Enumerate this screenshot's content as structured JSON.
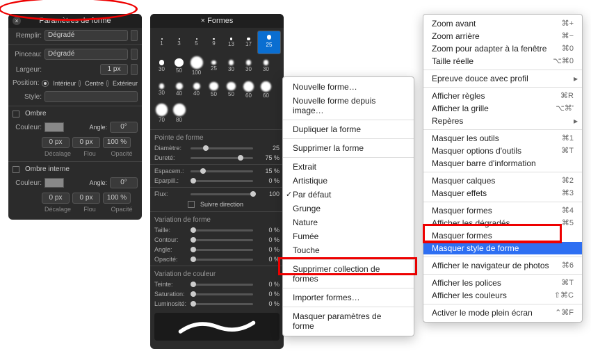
{
  "panel1": {
    "title": "Paramètres de forme",
    "fill_label": "Remplir:",
    "fill_value": "Dégradé",
    "brush_label": "Pinceau:",
    "brush_value": "Dégradé",
    "width_label": "Largeur:",
    "width_value": "1 px",
    "position_label": "Position:",
    "pos_inner": "Intérieur",
    "pos_center": "Centre",
    "pos_outer": "Extérieur",
    "style_label": "Style:",
    "shadow_label": "Ombre",
    "color_label": "Couleur:",
    "angle_label": "Angle:",
    "angle_value": "0°",
    "offset_value": "0 px",
    "blur_value": "0 px",
    "opacity_value": "100 %",
    "sub_offset": "Décalage",
    "sub_blur": "Flou",
    "sub_opacity": "Opacité",
    "inner_shadow_label": "Ombre interne"
  },
  "panel2": {
    "title": "Formes",
    "brushes": [
      1,
      3,
      5,
      9,
      13,
      17,
      25,
      30,
      50,
      100,
      25,
      30,
      30,
      30,
      30,
      40,
      40,
      50,
      50,
      60,
      60,
      70,
      80
    ],
    "selected_index": 6,
    "sec_tip": "Pointe de forme",
    "diam_label": "Diamètre:",
    "diam_value": "25",
    "hard_label": "Dureté:",
    "hard_value": "75 %",
    "spacing_label": "Espacem.:",
    "spacing_value": "15 %",
    "scatter_label": "Eparpill.:",
    "scatter_value": "0 %",
    "flux_label": "Flux:",
    "flux_value": "100",
    "follow_label": "Suivre direction",
    "sec_shape": "Variation de forme",
    "size_label": "Taille:",
    "size_value": "0 %",
    "contour_label": "Contour:",
    "contour_value": "0 %",
    "angle2_label": "Angle:",
    "angle2_value": "0 %",
    "opacity2_label": "Opacité:",
    "opacity2_value": "0 %",
    "sec_color": "Variation de couleur",
    "hue_label": "Teinte:",
    "hue_value": "0 %",
    "sat_label": "Saturation:",
    "sat_value": "0 %",
    "lum_label": "Luminosité:",
    "lum_value": "0 %"
  },
  "menu1": {
    "items": [
      {
        "label": "Nouvelle forme…"
      },
      {
        "label": "Nouvelle forme depuis image…"
      },
      {
        "sep": true
      },
      {
        "label": "Dupliquer la forme"
      },
      {
        "sep": true
      },
      {
        "label": "Supprimer la forme"
      },
      {
        "sep": true
      },
      {
        "label": "Extrait"
      },
      {
        "label": "Artistique"
      },
      {
        "label": "Par défaut",
        "checked": true
      },
      {
        "label": "Grunge"
      },
      {
        "label": "Nature"
      },
      {
        "label": "Fumée"
      },
      {
        "label": "Touche"
      },
      {
        "sep": true
      },
      {
        "label": "Supprimer collection de formes"
      },
      {
        "sep": true
      },
      {
        "label": "Importer formes…"
      },
      {
        "sep": true
      },
      {
        "label": "Masquer paramètres de forme"
      }
    ]
  },
  "menu2": {
    "items": [
      {
        "label": "Zoom avant",
        "shortcut": "⌘+"
      },
      {
        "label": "Zoom arrière",
        "shortcut": "⌘−"
      },
      {
        "label": "Zoom pour adapter à la fenêtre",
        "shortcut": "⌘0"
      },
      {
        "label": "Taille réelle",
        "shortcut": "⌥⌘0"
      },
      {
        "sep": true
      },
      {
        "label": "Epreuve douce avec profil",
        "arrow": true
      },
      {
        "sep": true
      },
      {
        "label": "Afficher règles",
        "shortcut": "⌘R"
      },
      {
        "label": "Afficher la grille",
        "shortcut": "⌥⌘'"
      },
      {
        "label": "Repères",
        "arrow": true
      },
      {
        "sep": true
      },
      {
        "label": "Masquer les outils",
        "shortcut": "⌘1"
      },
      {
        "label": "Masquer options d'outils",
        "shortcut": "⌘T"
      },
      {
        "label": "Masquer barre d'information"
      },
      {
        "sep": true
      },
      {
        "label": "Masquer calques",
        "shortcut": "⌘2"
      },
      {
        "label": "Masquer effets",
        "shortcut": "⌘3"
      },
      {
        "sep": true
      },
      {
        "label": "Masquer formes",
        "shortcut": "⌘4"
      },
      {
        "label": "Afficher les dégradés",
        "shortcut": "⌘5"
      },
      {
        "label": "Masquer formes"
      },
      {
        "label": "Masquer style de forme",
        "highlight": true
      },
      {
        "sep": true
      },
      {
        "label": "Afficher le navigateur de photos",
        "shortcut": "⌘6"
      },
      {
        "sep": true
      },
      {
        "label": "Afficher les polices",
        "shortcut": "⌘T"
      },
      {
        "label": "Afficher les couleurs",
        "shortcut": "⇧⌘C"
      },
      {
        "sep": true
      },
      {
        "label": "Activer le mode plein écran",
        "shortcut": "⌃⌘F"
      }
    ]
  }
}
